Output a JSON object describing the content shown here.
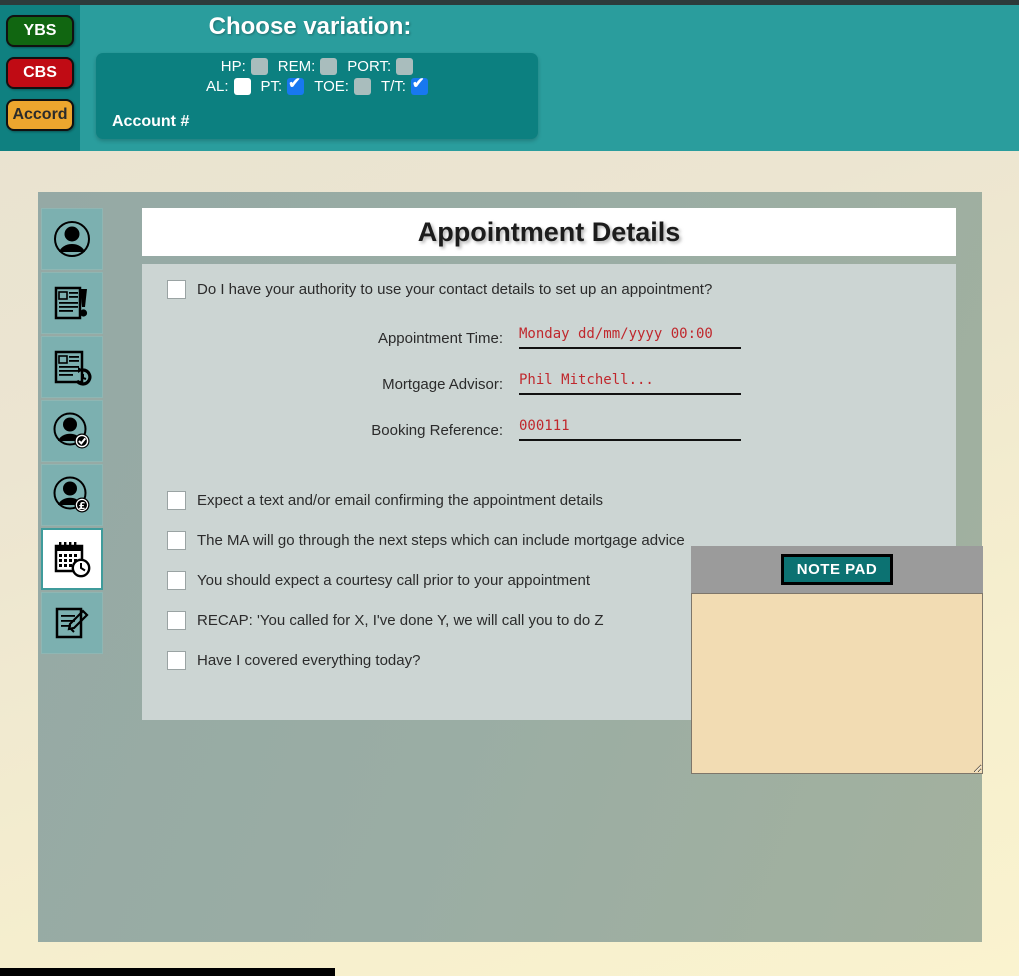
{
  "header": {
    "variation_title": "Choose variation:",
    "account_label": "Account #",
    "brands": [
      {
        "label": "YBS",
        "name": "brand-button-ybs",
        "color": "#116611"
      },
      {
        "label": "CBS",
        "name": "brand-button-cbs",
        "color": "#c00b14"
      },
      {
        "label": "Accord",
        "name": "brand-button-accord",
        "color": "#eda62e"
      }
    ],
    "variation_row1": [
      {
        "label": "HP:",
        "state": "disabled"
      },
      {
        "label": "REM:",
        "state": "disabled"
      },
      {
        "label": "PORT:",
        "state": "disabled"
      }
    ],
    "variation_row2": [
      {
        "label": "AL:",
        "state": "unchecked"
      },
      {
        "label": "PT:",
        "state": "checked"
      },
      {
        "label": "TOE:",
        "state": "disabled"
      },
      {
        "label": "T/T:",
        "state": "checked"
      }
    ]
  },
  "sidebar": {
    "items": [
      {
        "icon": "person-icon",
        "active": false
      },
      {
        "icon": "document-alert-icon",
        "active": false
      },
      {
        "icon": "document-history-icon",
        "active": false
      },
      {
        "icon": "person-check-icon",
        "active": false
      },
      {
        "icon": "person-pound-icon",
        "active": false
      },
      {
        "icon": "calendar-clock-icon",
        "active": true
      },
      {
        "icon": "document-pencil-icon",
        "active": false
      }
    ]
  },
  "main": {
    "page_title": "Appointment Details",
    "authority_question": "Do I have your authority to use your contact details to set up an appointment?",
    "fields": [
      {
        "label": "Appointment Time:",
        "value": "Monday dd/mm/yyyy 00:00"
      },
      {
        "label": "Mortgage Advisor:",
        "value": "Phil Mitchell..."
      },
      {
        "label": "Booking Reference:",
        "value": "000111"
      }
    ],
    "checklist": [
      "Expect a text and/or email confirming the appointment details",
      "The MA will go through the next steps which can include mortgage advice",
      "You should expect a courtesy call prior to your appointment",
      "RECAP: 'You called for X, I've done Y, we will call you to do Z",
      "Have I covered everything today?"
    ]
  },
  "notepad": {
    "button_label": "NOTE  PAD",
    "value": "",
    "placeholder": ""
  }
}
